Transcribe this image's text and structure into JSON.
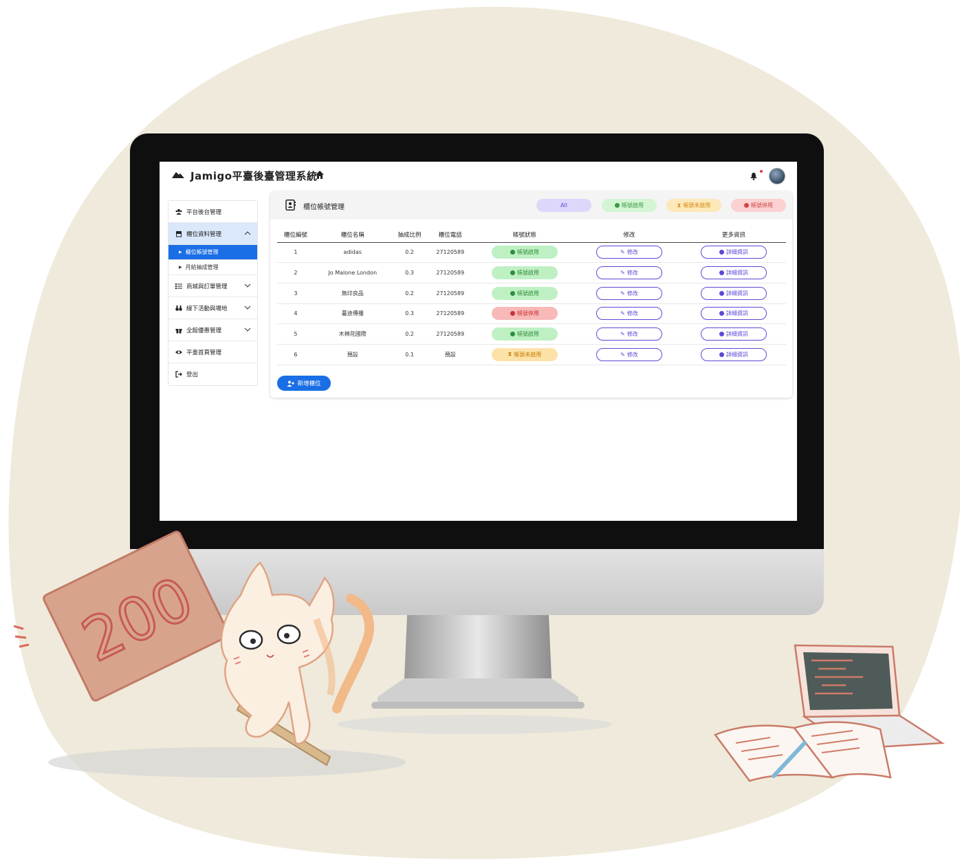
{
  "app": {
    "title": "Jamigo平臺後臺管理系統"
  },
  "sidebar": {
    "items": [
      {
        "label": "平台後台管理",
        "icon": "users-icon"
      },
      {
        "label": "櫃位資料管理",
        "icon": "store-icon"
      },
      {
        "label": "商城與訂單管理",
        "icon": "list-icon"
      },
      {
        "label": "線下活動與場地",
        "icon": "binoculars-icon"
      },
      {
        "label": "全館優惠管理",
        "icon": "gift-icon"
      },
      {
        "label": "平臺首頁管理",
        "icon": "eye-icon"
      },
      {
        "label": "登出",
        "icon": "logout-icon"
      }
    ],
    "subitems": [
      {
        "label": "櫃位帳號管理"
      },
      {
        "label": "月結抽成管理"
      }
    ]
  },
  "page": {
    "title": "櫃位帳號管理",
    "filters": {
      "all": "All",
      "enabled": "帳號啟用",
      "pending": "帳號未啟用",
      "disabled": "帳號停用"
    }
  },
  "table": {
    "headers": [
      "櫃位編號",
      "櫃位名稱",
      "抽成比例",
      "櫃位電話",
      "帳號狀態",
      "修改",
      "更多資訊"
    ],
    "edit_label": "修改",
    "detail_label": "詳細資訊",
    "rows": [
      {
        "id": "1",
        "name": "adidas",
        "ratio": "0.2",
        "phone": "27120589",
        "status": "帳號啟用",
        "status_type": "on"
      },
      {
        "id": "2",
        "name": "Jo Malone London",
        "ratio": "0.3",
        "phone": "27120589",
        "status": "帳號啟用",
        "status_type": "on"
      },
      {
        "id": "3",
        "name": "無印良品",
        "ratio": "0.2",
        "phone": "27120589",
        "status": "帳號啟用",
        "status_type": "on"
      },
      {
        "id": "4",
        "name": "蔓迪傳播",
        "ratio": "0.3",
        "phone": "27120589",
        "status": "帳號停用",
        "status_type": "off"
      },
      {
        "id": "5",
        "name": "木棉花國際",
        "ratio": "0.2",
        "phone": "27120589",
        "status": "帳號啟用",
        "status_type": "on"
      },
      {
        "id": "6",
        "name": "預設",
        "ratio": "0.1",
        "phone": "預設",
        "status": "帳號未啟用",
        "status_type": "pending"
      }
    ]
  },
  "add_button": {
    "label": "新增櫃位"
  },
  "illustration": {
    "sign_text": "200"
  },
  "colors": {
    "primary": "#1a6ee6",
    "accent": "#5a48d6",
    "background_blob": "#efeadb",
    "enabled": "#2f8e3a",
    "disabled": "#c33333",
    "pending": "#c27b00"
  }
}
